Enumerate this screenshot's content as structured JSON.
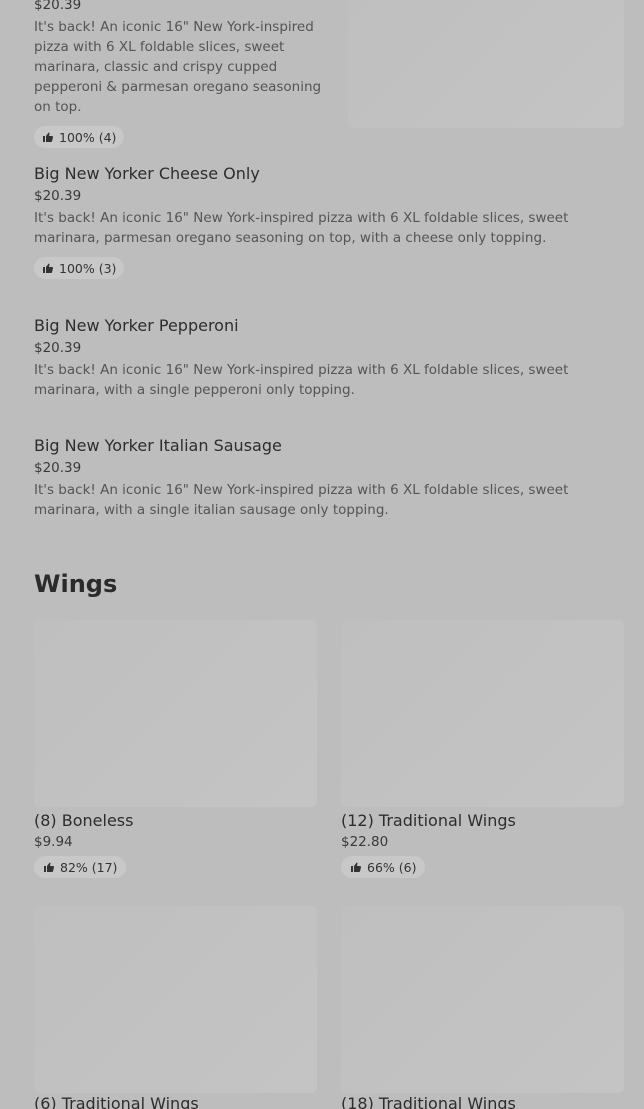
{
  "pizza_items": [
    {
      "price": "$20.39",
      "description": "It's back! An iconic 16\" New York-inspired pizza with 6 XL foldable slices, sweet marinara, classic and crispy cupped pepperoni & parmesan oregano seasoning on top.",
      "rating": "100% (4)"
    },
    {
      "title": "Big New Yorker Cheese Only",
      "price": "$20.39",
      "description": "It's back! An iconic 16\" New York-inspired pizza with 6 XL foldable slices, sweet marinara, parmesan oregano seasoning on top, with a cheese only topping.",
      "rating": "100% (3)"
    },
    {
      "title": "Big New Yorker Pepperoni",
      "price": "$20.39",
      "description": "It's back! An iconic 16\" New York-inspired pizza with 6 XL foldable slices, sweet marinara, with a single pepperoni only topping."
    },
    {
      "title": "Big New Yorker Italian Sausage",
      "price": "$20.39",
      "description": "It's back! An iconic 16\" New York-inspired pizza with 6 XL foldable slices, sweet marinara, with a single italian sausage only topping."
    }
  ],
  "wings_section": {
    "title": "Wings",
    "cards": [
      {
        "title": "(8) Boneless",
        "price": "$9.94",
        "rating": "82% (17)"
      },
      {
        "title": "(12) Traditional Wings",
        "price": "$22.80",
        "rating": "66% (6)"
      },
      {
        "title": "(6) Traditional Wings"
      },
      {
        "title": "(18) Traditional Wings"
      }
    ]
  },
  "icons": {
    "rating": "thumbs-up-icon"
  }
}
